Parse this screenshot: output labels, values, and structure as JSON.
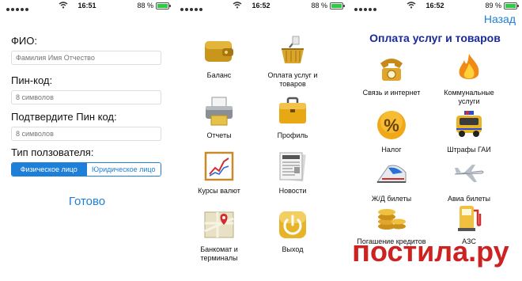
{
  "screens": [
    {
      "status": {
        "time": "16:51",
        "battery": "88 %",
        "battery_level": 0.88
      }
    },
    {
      "status": {
        "time": "16:52",
        "battery": "88 %",
        "battery_level": 0.88
      }
    },
    {
      "status": {
        "time": "16:52",
        "battery": "89 %",
        "battery_level": 0.89
      }
    }
  ],
  "registration": {
    "fio_label": "ФИО:",
    "fio_placeholder": "Фамилия Имя Отчество",
    "pin_label": "Пин-код:",
    "pin_placeholder": "8 символов",
    "confirm_label": "Подтвердите Пин код:",
    "confirm_placeholder": "8 символов",
    "user_type_label": "Тип ползователя:",
    "segments": [
      "Физическое лицо",
      "Юридическое лицо"
    ],
    "done_label": "Готово"
  },
  "menu": {
    "items": [
      {
        "label": "Баланс",
        "icon": "wallet-icon"
      },
      {
        "label": "Оплата услуг и товаров",
        "icon": "shopping-basket-icon"
      },
      {
        "label": "Отчеты",
        "icon": "printer-icon"
      },
      {
        "label": "Профиль",
        "icon": "briefcase-icon"
      },
      {
        "label": "Курсы валют",
        "icon": "chart-icon"
      },
      {
        "label": "Новости",
        "icon": "newspaper-icon"
      },
      {
        "label": "Банкомат и терминалы",
        "icon": "map-icon"
      },
      {
        "label": "Выход",
        "icon": "power-icon"
      }
    ]
  },
  "payments": {
    "back_label": "Назад",
    "title": "Оплата услуг и товаров",
    "items": [
      {
        "label": "Связь и интернет",
        "icon": "phone-icon"
      },
      {
        "label": "Коммунальные услуги",
        "icon": "flame-icon"
      },
      {
        "label": "Налог",
        "icon": "percent-icon"
      },
      {
        "label": "Штрафы ГАИ",
        "icon": "police-car-icon"
      },
      {
        "label": "Ж/Д билеты",
        "icon": "train-icon"
      },
      {
        "label": "Авиа билеты",
        "icon": "airplane-icon"
      },
      {
        "label": "Погашение кредитов",
        "icon": "coins-icon"
      },
      {
        "label": "АЗС",
        "icon": "fuel-pump-icon"
      }
    ]
  },
  "watermark": {
    "text": "остила.ру"
  },
  "colors": {
    "accent": "#1e7fd8",
    "title": "#1a2a9a",
    "watermark": "#cc2222"
  }
}
